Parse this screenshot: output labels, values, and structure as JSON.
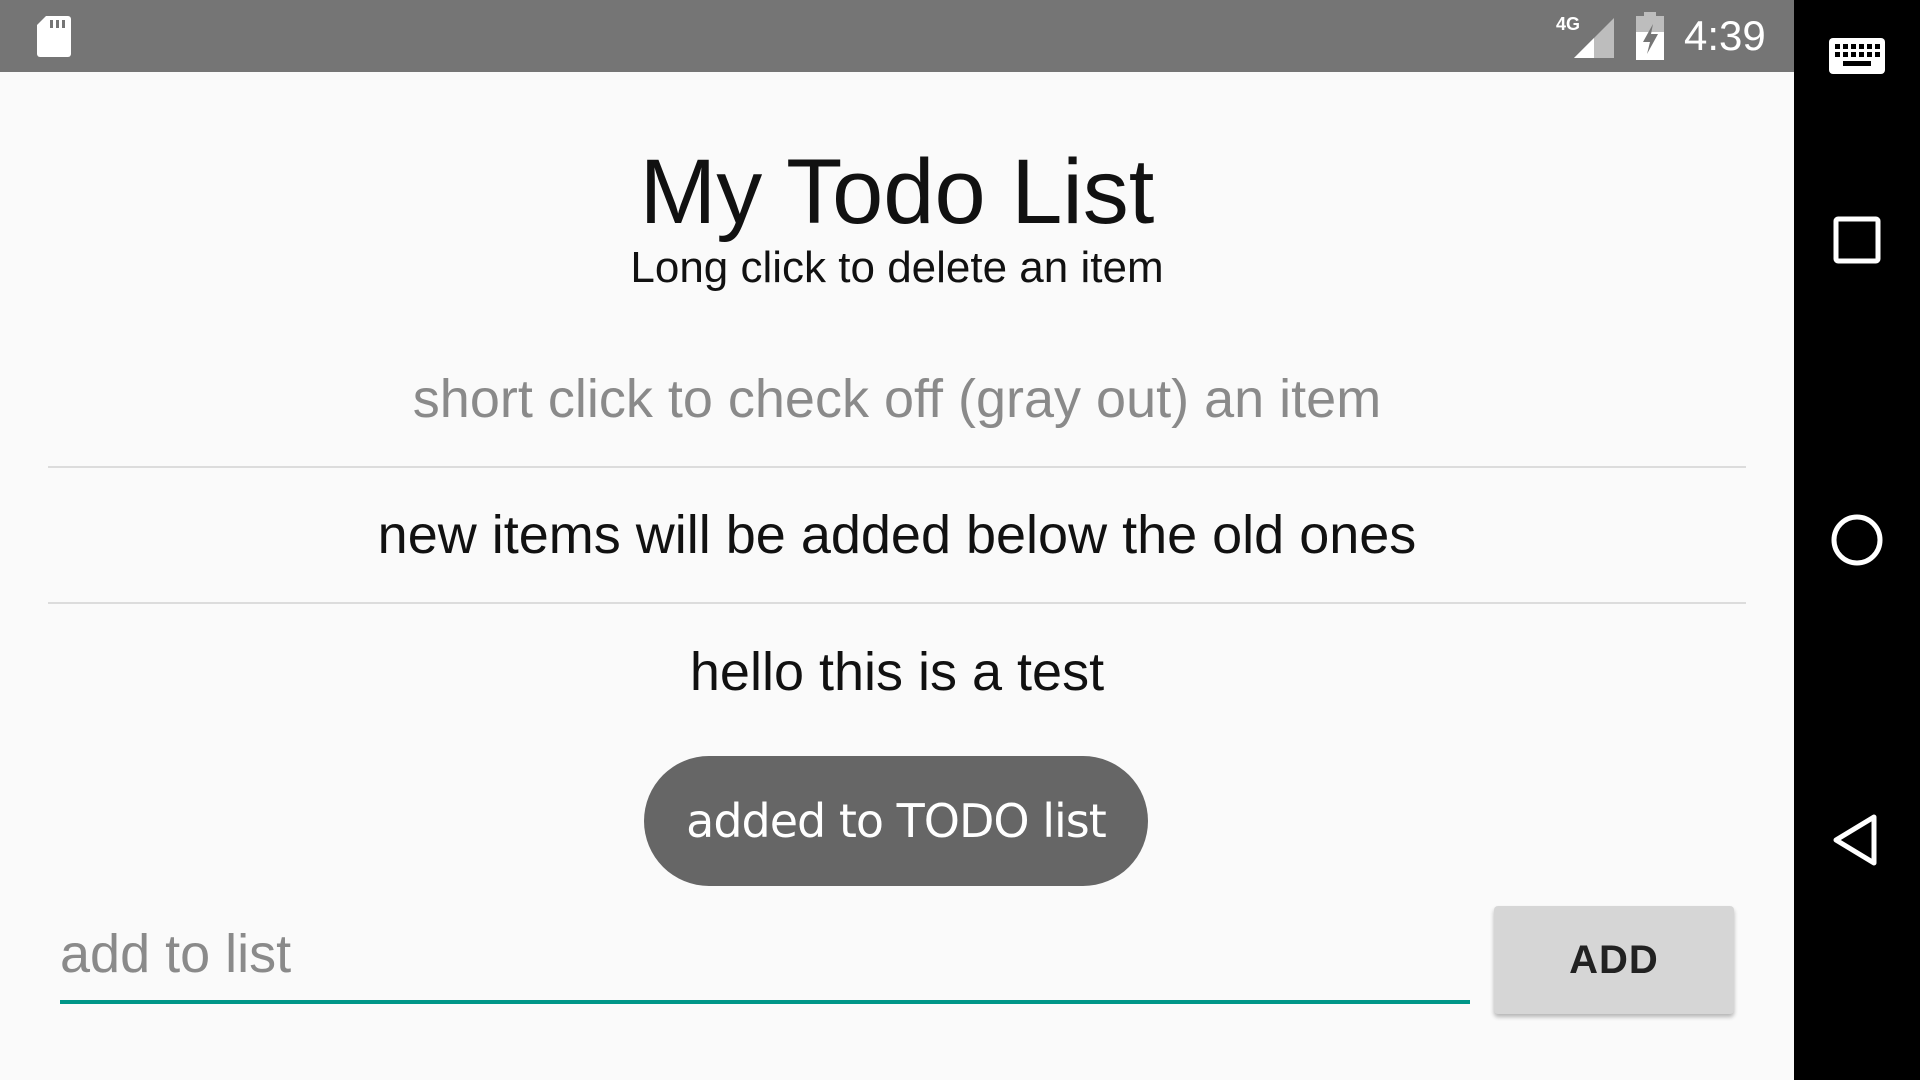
{
  "status_bar": {
    "time": "4:39",
    "network_type": "4G",
    "icons": [
      "sd-card-icon",
      "signal-4g-icon",
      "battery-charging-icon"
    ]
  },
  "nav_bar": {
    "icons": [
      "keyboard-icon",
      "recents-icon",
      "home-icon",
      "back-icon"
    ]
  },
  "app": {
    "title": "My Todo List",
    "subtitle": "Long click to delete an item"
  },
  "todo_items": [
    {
      "text": "short click to check off (gray out) an item",
      "checked": true
    },
    {
      "text": "new items will be added below the old ones",
      "checked": false
    },
    {
      "text": "hello this is a test",
      "checked": false
    }
  ],
  "toast": {
    "message": "added to TODO list"
  },
  "input": {
    "placeholder": "add to list",
    "value": ""
  },
  "add_button": {
    "label": "ADD"
  },
  "colors": {
    "status_bar": "#757575",
    "nav_bar": "#000000",
    "background": "#fafafa",
    "accent": "#009688",
    "toast_bg": "#666666",
    "checked_text": "#8a8a8a"
  }
}
